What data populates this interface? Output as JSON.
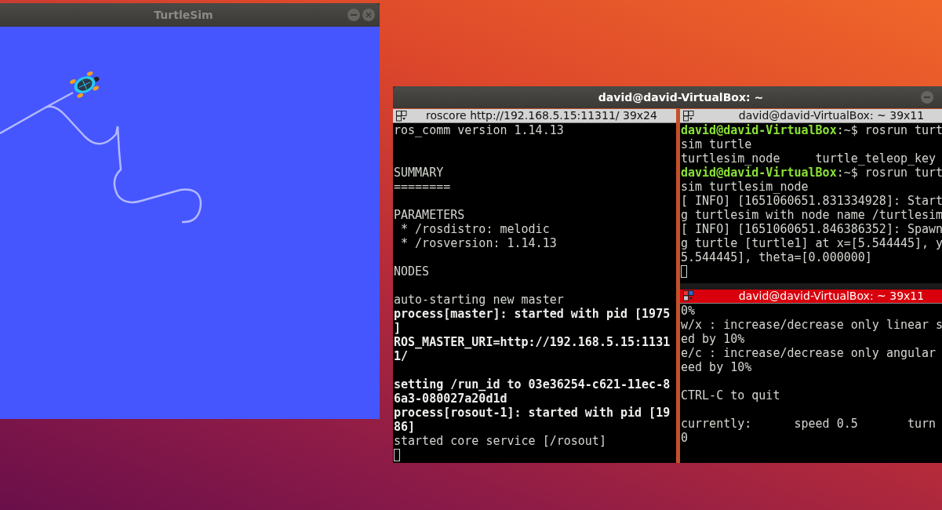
{
  "turtlesim": {
    "title": "TurtleSim"
  },
  "terminal": {
    "title": "david@david-VirtualBox: ~",
    "panes": [
      {
        "header": "roscore http://192.168.5.15:11311/ 39x24",
        "selected": false,
        "lines": [
          {
            "kind": "plain",
            "text": "ros_comm version 1.14.13"
          },
          {
            "kind": "blank"
          },
          {
            "kind": "blank"
          },
          {
            "kind": "plain",
            "text": "SUMMARY"
          },
          {
            "kind": "plain",
            "text": "========"
          },
          {
            "kind": "blank"
          },
          {
            "kind": "plain",
            "text": "PARAMETERS"
          },
          {
            "kind": "plain",
            "text": " * /rosdistro: melodic"
          },
          {
            "kind": "plain",
            "text": " * /rosversion: 1.14.13"
          },
          {
            "kind": "blank"
          },
          {
            "kind": "plain",
            "text": "NODES"
          },
          {
            "kind": "blank"
          },
          {
            "kind": "plain",
            "text": "auto-starting new master"
          },
          {
            "kind": "bold",
            "text": "process[master]: started with pid [1975"
          },
          {
            "kind": "bold",
            "text": "]"
          },
          {
            "kind": "bold",
            "text": "ROS_MASTER_URI=http://192.168.5.15:1131"
          },
          {
            "kind": "bold",
            "text": "1/"
          },
          {
            "kind": "blank"
          },
          {
            "kind": "bold",
            "text": "setting /run_id to 03e36254-c621-11ec-8"
          },
          {
            "kind": "bold",
            "text": "6a3-080027a20d1d"
          },
          {
            "kind": "bold",
            "text": "process[rosout-1]: started with pid [19"
          },
          {
            "kind": "bold",
            "text": "86]"
          },
          {
            "kind": "plain",
            "text": "started core service [/rosout]"
          },
          {
            "kind": "cursor"
          }
        ]
      },
      {
        "header": "david@david-VirtualBox: ~ 39x11",
        "selected": false,
        "lines": [
          {
            "kind": "prompt",
            "prompt": "david@david-VirtualBox",
            "text": ":~$ rosrun turt"
          },
          {
            "kind": "plain",
            "text": "sim turtle"
          },
          {
            "kind": "plain",
            "text": "turtlesim_node     turtle_teleop_key"
          },
          {
            "kind": "prompt",
            "prompt": "david@david-VirtualBox",
            "text": ":~$ rosrun turt"
          },
          {
            "kind": "plain",
            "text": "sim turtlesim_node"
          },
          {
            "kind": "plain",
            "text": "[ INFO] [1651060651.831334928]: Start"
          },
          {
            "kind": "plain",
            "text": "g turtlesim with node name /turtlesim"
          },
          {
            "kind": "plain",
            "text": "[ INFO] [1651060651.846386352]: Spawn"
          },
          {
            "kind": "plain",
            "text": "g turtle [turtle1] at x=[5.544445], y"
          },
          {
            "kind": "plain",
            "text": "5.544445], theta=[0.000000]"
          },
          {
            "kind": "cursor"
          }
        ]
      },
      {
        "header": "david@david-VirtualBox: ~ 39x11",
        "selected": true,
        "lines": [
          {
            "kind": "plain",
            "text": "0%"
          },
          {
            "kind": "plain",
            "text": "w/x : increase/decrease only linear s"
          },
          {
            "kind": "plain",
            "text": "ed by 10%"
          },
          {
            "kind": "plain",
            "text": "e/c : increase/decrease only angular"
          },
          {
            "kind": "plain",
            "text": "eed by 10%"
          },
          {
            "kind": "blank"
          },
          {
            "kind": "plain",
            "text": "CTRL-C to quit"
          },
          {
            "kind": "blank"
          },
          {
            "kind": "plain",
            "text": "currently:      speed 0.5       turn"
          },
          {
            "kind": "plain",
            "text": "0"
          }
        ]
      }
    ]
  }
}
